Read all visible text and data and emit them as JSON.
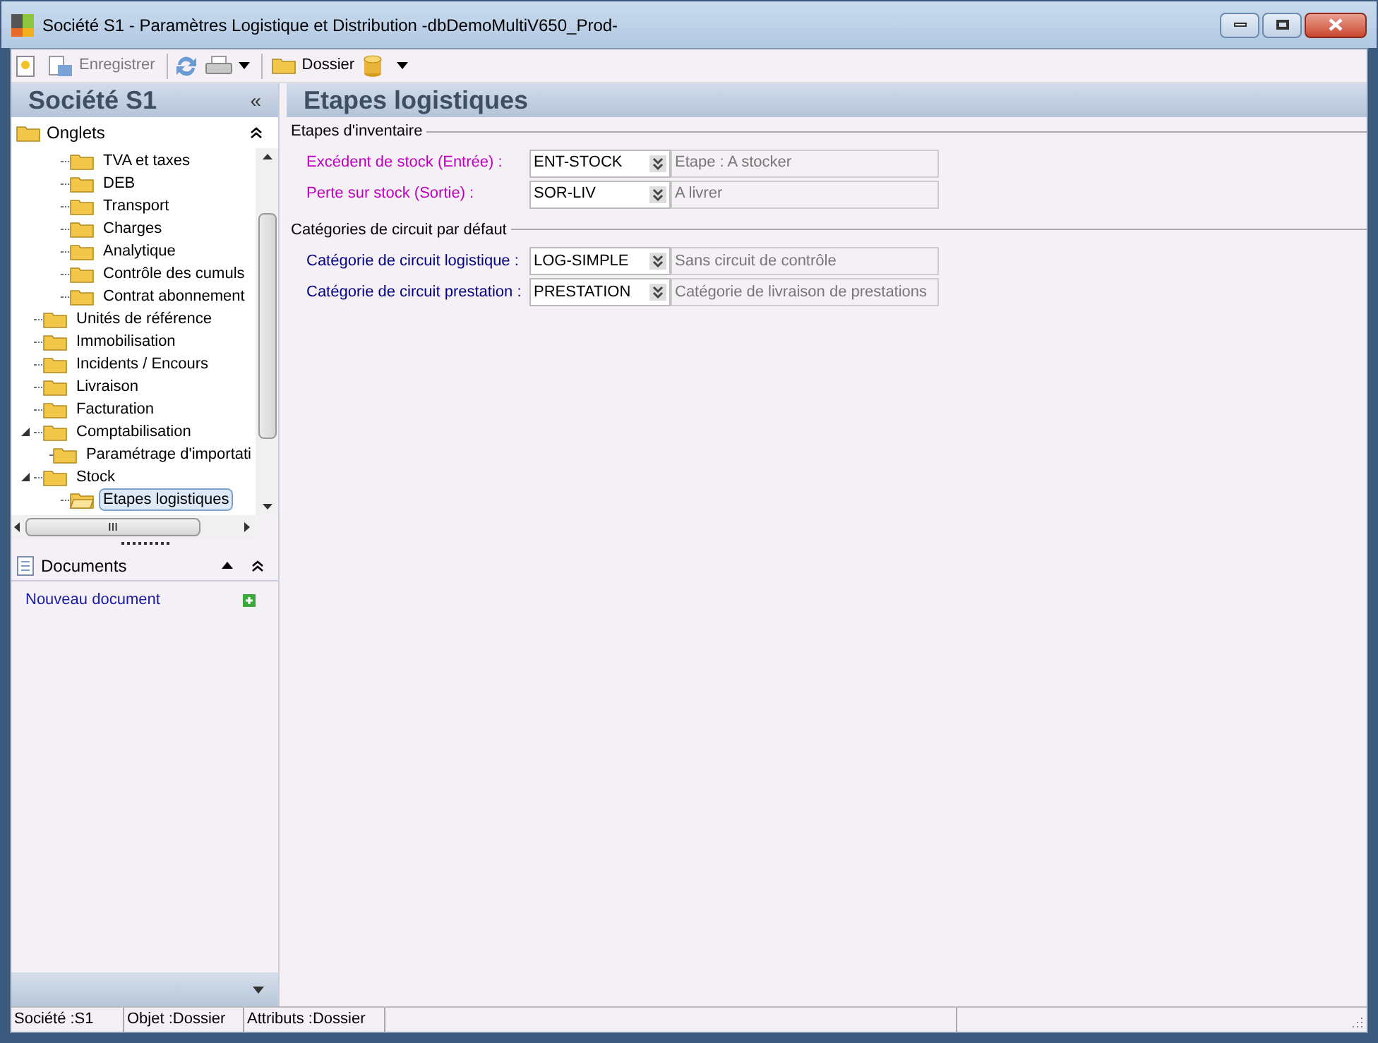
{
  "window": {
    "title": "Société S1 -  Paramètres Logistique et Distribution -dbDemoMultiV650_Prod-"
  },
  "toolbar": {
    "save": "Enregistrer",
    "folder": "Dossier"
  },
  "sidebar": {
    "title": "Société S1",
    "collapse": "«",
    "tabs_section": {
      "title": "Onglets",
      "tree": [
        {
          "children": [
            {
              "label": "TVA et taxes",
              "selected": false
            },
            {
              "label": "DEB",
              "selected": false
            },
            {
              "label": "Transport",
              "selected": false
            },
            {
              "label": "Charges",
              "selected": false
            },
            {
              "label": "Analytique",
              "selected": false
            },
            {
              "label": "Contrôle des cumuls",
              "selected": false
            },
            {
              "label": "Contrat abonnement",
              "selected": false
            }
          ]
        },
        {
          "label": "Unités de référence",
          "selected": false
        },
        {
          "label": "Immobilisation",
          "selected": false
        },
        {
          "label": "Incidents / Encours",
          "selected": false
        },
        {
          "label": "Livraison",
          "selected": false
        },
        {
          "label": "Facturation",
          "selected": false
        },
        {
          "label": "Comptabilisation",
          "selected": false,
          "expanded": true,
          "children": [
            {
              "label": "Paramétrage d'importati",
              "selected": false
            }
          ]
        },
        {
          "label": "Stock",
          "selected": false,
          "expanded": true,
          "children": [
            {
              "label": "Etapes logistiques",
              "selected": true
            }
          ]
        }
      ]
    },
    "scroll_mark": "III",
    "documents": {
      "title": "Documents",
      "link": "Nouveau document"
    }
  },
  "main": {
    "title": "Etapes logistiques",
    "groups": [
      {
        "title": "Etapes d'inventaire",
        "fields": [
          {
            "label": "Excédent de stock (Entrée) :",
            "color": "#c000c0",
            "value": "ENT-STOCK",
            "description": "Etape  : A stocker"
          },
          {
            "label": "Perte sur stock (Sortie) :",
            "color": "#c000c0",
            "value": "SOR-LIV",
            "description": "A livrer"
          }
        ]
      },
      {
        "title": "Catégories de circuit par défaut",
        "fields": [
          {
            "label": "Catégorie de circuit logistique :",
            "color": "#000080",
            "value": "LOG-SIMPLE",
            "description": "Sans  circuit de contrôle"
          },
          {
            "label": "Catégorie de circuit prestation :",
            "color": "#000080",
            "value": "PRESTATION",
            "description": "Catégorie de livraison de prestations"
          }
        ]
      }
    ]
  },
  "status_bar": [
    "Société :S1",
    "Objet :Dossier",
    "Attributs :Dossier"
  ]
}
